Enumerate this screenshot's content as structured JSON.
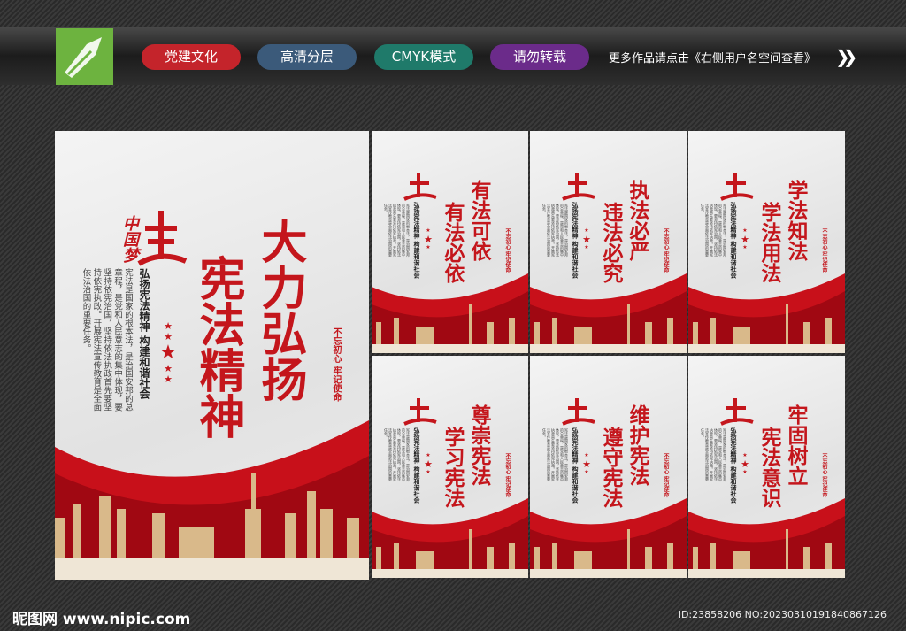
{
  "header": {
    "tags": [
      {
        "label": "党建文化",
        "color": "#c4242b"
      },
      {
        "label": "高清分层",
        "color": "#3b5a7a"
      },
      {
        "label": "CMYK模式",
        "color": "#1f7a6a"
      },
      {
        "label": "请勿转载",
        "color": "#6b2b8a"
      }
    ],
    "more_text": "更多作品请点击《右侧用户名空间查看》",
    "arrow": "❯❯"
  },
  "main_poster": {
    "logo_text": "中国梦",
    "title_right": "大力弘扬",
    "title_left": "宪法精神",
    "subtitle": "弘扬宪法精神  构建和谐社会",
    "body": "宪法是国家的根本法，是治国安邦的总章程，是党和人民意志的集中体现，要坚持依宪治国，坚持依法执政首先要坚持依宪执政。开展宪法宣传教育是全面依法治国的重要任务。",
    "seal": "不忘初心 牢记使命"
  },
  "posters": [
    {
      "right": "有法可依",
      "left": "有法必依"
    },
    {
      "right": "执法必严",
      "left": "违法必究"
    },
    {
      "right": "学法知法",
      "left": "学法用法"
    },
    {
      "right": "尊崇宪法",
      "left": "学习宪法"
    },
    {
      "right": "维护宪法",
      "left": "遵守宪法"
    },
    {
      "right": "牢固树立",
      "left": "宪法意识"
    }
  ],
  "footer": {
    "site": "昵图网 www.nipic.com",
    "id": "ID:23858206 NO:20230310191840867126"
  }
}
